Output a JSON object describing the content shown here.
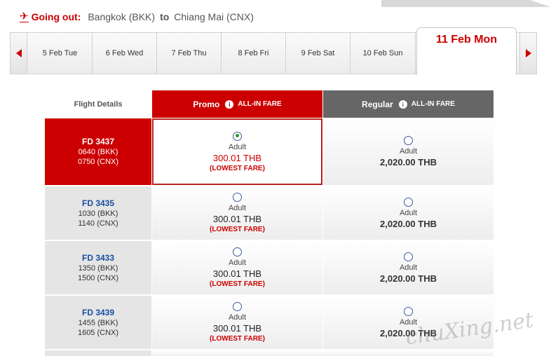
{
  "header": {
    "going_out_label": "Going out:",
    "origin": "Bangkok (BKK)",
    "to_label": "to",
    "destination": "Chiang Mai (CNX)"
  },
  "dates": [
    {
      "label": "5 Feb Tue",
      "active": false
    },
    {
      "label": "6 Feb Wed",
      "active": false
    },
    {
      "label": "7 Feb Thu",
      "active": false
    },
    {
      "label": "8 Feb Fri",
      "active": false
    },
    {
      "label": "9 Feb Sat",
      "active": false
    },
    {
      "label": "10 Feb Sun",
      "active": false
    },
    {
      "label": "11 Feb Mon",
      "active": true
    }
  ],
  "table": {
    "flight_details_header": "Flight Details",
    "promo_header": "Promo",
    "promo_all_in": "ALL-IN FARE",
    "regular_header": "Regular",
    "regular_all_in": "ALL-IN FARE"
  },
  "flights": [
    {
      "flight_no": "FD  3437",
      "depart": "0640  (BKK)",
      "arrive": "0750  (CNX)",
      "selected": true,
      "promo": {
        "pax": "Adult",
        "price": "300.01 THB",
        "note": "(LOWEST FARE)"
      },
      "regular": {
        "pax": "Adult",
        "price": "2,020.00 THB"
      }
    },
    {
      "flight_no": "FD  3435",
      "depart": "1030  (BKK)",
      "arrive": "1140  (CNX)",
      "selected": false,
      "promo": {
        "pax": "Adult",
        "price": "300.01 THB",
        "note": "(LOWEST FARE)"
      },
      "regular": {
        "pax": "Adult",
        "price": "2,020.00 THB"
      }
    },
    {
      "flight_no": "FD  3433",
      "depart": "1350  (BKK)",
      "arrive": "1500  (CNX)",
      "selected": false,
      "promo": {
        "pax": "Adult",
        "price": "300.01 THB",
        "note": "(LOWEST FARE)"
      },
      "regular": {
        "pax": "Adult",
        "price": "2,020.00 THB"
      }
    },
    {
      "flight_no": "FD  3439",
      "depart": "1455  (BKK)",
      "arrive": "1605  (CNX)",
      "selected": false,
      "promo": {
        "pax": "Adult",
        "price": "300.01 THB",
        "note": "(LOWEST FARE)"
      },
      "regular": {
        "pax": "Adult",
        "price": "2,020.00 THB"
      }
    }
  ],
  "watermark": "chuXing.net",
  "colors": {
    "accent": "#cc0000",
    "regular_header": "#666666",
    "flight_link": "#1a4fa0"
  }
}
